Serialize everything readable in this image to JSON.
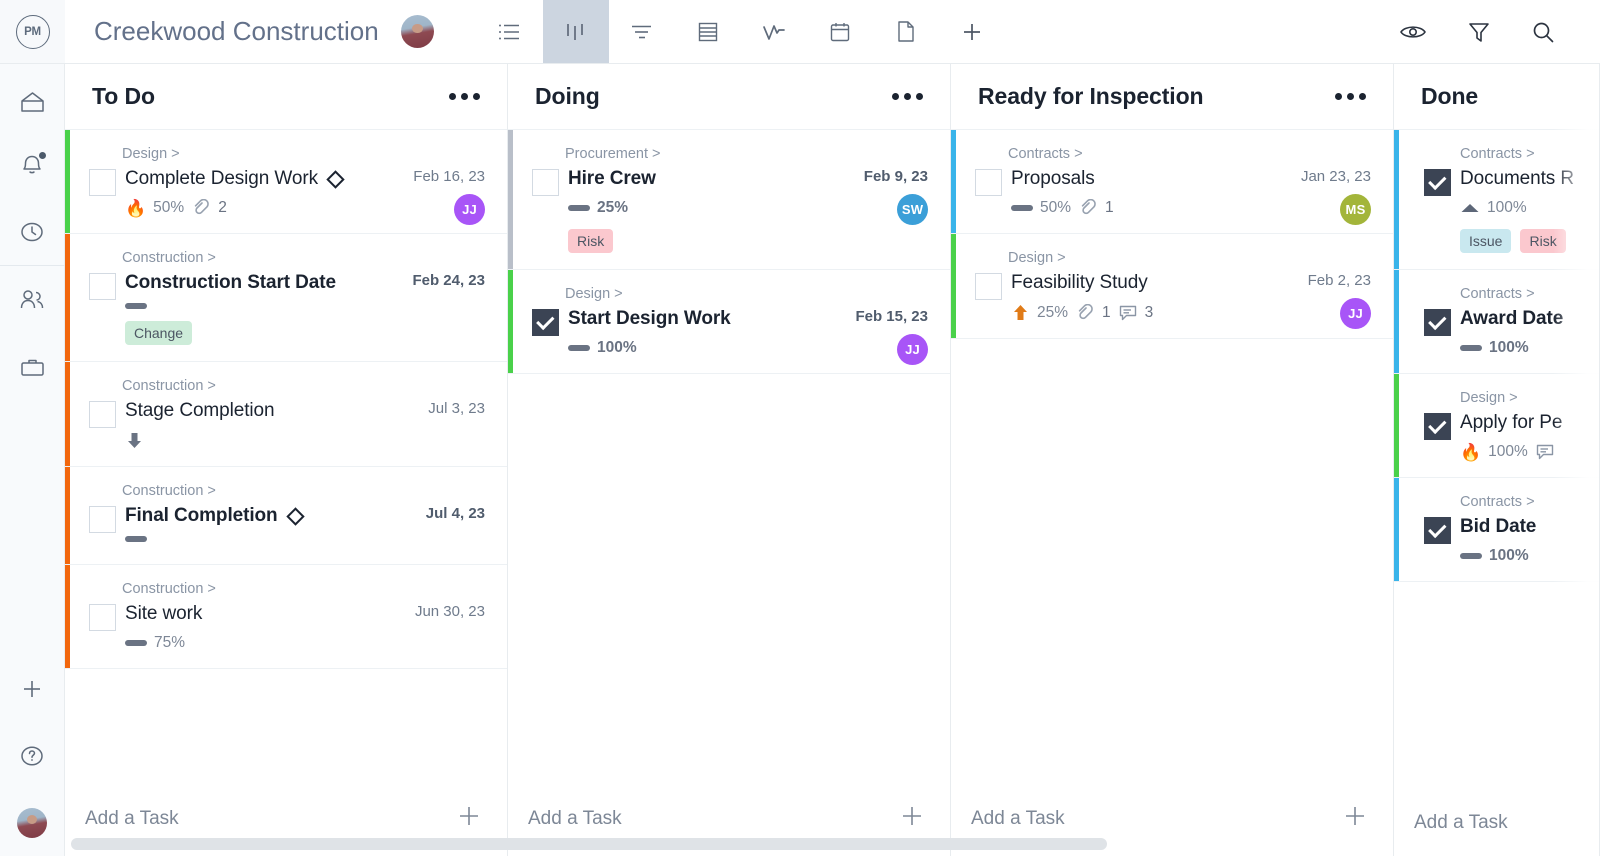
{
  "header": {
    "logo_text": "PM",
    "project_title": "Creekwood Construction",
    "avatar_name": "project-owner-avatar",
    "view_tabs": [
      {
        "icon": "list-view-icon",
        "label": "List",
        "active": false
      },
      {
        "icon": "board-view-icon",
        "label": "Board",
        "active": true
      },
      {
        "icon": "gantt-view-icon",
        "label": "Gantt",
        "active": false
      },
      {
        "icon": "sheet-view-icon",
        "label": "Sheet",
        "active": false
      },
      {
        "icon": "workload-view-icon",
        "label": "Workload",
        "active": false
      },
      {
        "icon": "calendar-view-icon",
        "label": "Calendar",
        "active": false
      },
      {
        "icon": "page-view-icon",
        "label": "Page",
        "active": false
      },
      {
        "icon": "add-view-icon",
        "label": "Add view",
        "active": false
      }
    ],
    "right_actions": [
      {
        "icon": "eye-icon",
        "label": "Watch"
      },
      {
        "icon": "filter-icon",
        "label": "Filter"
      },
      {
        "icon": "search-icon",
        "label": "Search"
      }
    ]
  },
  "sidebar": {
    "items": [
      {
        "icon": "home-icon",
        "label": "Home"
      },
      {
        "icon": "bell-icon",
        "label": "Notifications",
        "badge": true
      },
      {
        "icon": "clock-icon",
        "label": "Time"
      },
      {
        "icon": "people-icon",
        "label": "Team"
      },
      {
        "icon": "briefcase-icon",
        "label": "Portfolio"
      }
    ],
    "bottom_items": [
      {
        "icon": "plus-icon",
        "label": "Add"
      },
      {
        "icon": "help-icon",
        "label": "Help"
      },
      {
        "icon": "user-avatar",
        "label": "Account"
      }
    ]
  },
  "board": {
    "add_task_label": "Add a Task",
    "columns": [
      {
        "title": "To Do",
        "clipped": false,
        "cards": [
          {
            "category": "Design >",
            "title": "Complete Design Work",
            "bold": false,
            "milestone": true,
            "checked": false,
            "accent": "#4ad14a",
            "date": "Feb 16, 23",
            "date_bold": false,
            "priority": "flame",
            "progress": "50%",
            "progress_bold": false,
            "links": "2",
            "comments": null,
            "avatar": {
              "initials": "JJ",
              "color": "#a855f7"
            },
            "tags": []
          },
          {
            "category": "Construction >",
            "title": "Construction Start Date",
            "bold": true,
            "milestone": false,
            "checked": false,
            "accent": "#f2670e",
            "date": "Feb 24, 23",
            "date_bold": true,
            "priority": "bar",
            "progress": "",
            "progress_bold": true,
            "links": null,
            "comments": null,
            "avatar": null,
            "tags": [
              {
                "label": "Change",
                "style": "change"
              }
            ]
          },
          {
            "category": "Construction >",
            "title": "Stage Completion",
            "bold": false,
            "milestone": false,
            "checked": false,
            "accent": "#f2670e",
            "date": "Jul 3, 23",
            "date_bold": false,
            "priority": "down",
            "progress": "",
            "progress_bold": false,
            "links": null,
            "comments": null,
            "avatar": null,
            "tags": []
          },
          {
            "category": "Construction >",
            "title": "Final Completion",
            "bold": true,
            "milestone": true,
            "checked": false,
            "accent": "#f2670e",
            "date": "Jul 4, 23",
            "date_bold": true,
            "priority": "bar",
            "progress": "",
            "progress_bold": true,
            "links": null,
            "comments": null,
            "avatar": null,
            "tags": []
          },
          {
            "category": "Construction >",
            "title": "Site work",
            "bold": false,
            "milestone": false,
            "checked": false,
            "accent": "#f2670e",
            "date": "Jun 30, 23",
            "date_bold": false,
            "priority": "bar",
            "progress": "75%",
            "progress_bold": false,
            "links": null,
            "comments": null,
            "avatar": null,
            "tags": []
          }
        ]
      },
      {
        "title": "Doing",
        "clipped": false,
        "cards": [
          {
            "category": "Procurement >",
            "title": "Hire Crew",
            "bold": true,
            "milestone": false,
            "checked": false,
            "accent": "#b9bfc9",
            "date": "Feb 9, 23",
            "date_bold": true,
            "priority": "bar",
            "progress": "25%",
            "progress_bold": true,
            "links": null,
            "comments": null,
            "avatar": {
              "initials": "SW",
              "color": "#3b9fd8"
            },
            "tags": [
              {
                "label": "Risk",
                "style": "risk"
              }
            ]
          },
          {
            "category": "Design >",
            "title": "Start Design Work",
            "bold": true,
            "milestone": false,
            "checked": true,
            "accent": "#4ad14a",
            "date": "Feb 15, 23",
            "date_bold": true,
            "priority": "bar",
            "progress": "100%",
            "progress_bold": true,
            "links": null,
            "comments": null,
            "avatar": {
              "initials": "JJ",
              "color": "#a855f7"
            },
            "tags": []
          }
        ]
      },
      {
        "title": "Ready for Inspection",
        "clipped": false,
        "cards": [
          {
            "category": "Contracts >",
            "title": "Proposals",
            "bold": false,
            "milestone": false,
            "checked": false,
            "accent": "#39b4ea",
            "date": "Jan 23, 23",
            "date_bold": false,
            "priority": "bar",
            "progress": "50%",
            "progress_bold": false,
            "links": "1",
            "comments": null,
            "avatar": {
              "initials": "MS",
              "color": "#a3b53a"
            },
            "tags": []
          },
          {
            "category": "Design >",
            "title": "Feasibility Study",
            "bold": false,
            "milestone": false,
            "checked": false,
            "accent": "#4ad14a",
            "date": "Feb 2, 23",
            "date_bold": false,
            "priority": "up",
            "progress": "25%",
            "progress_bold": false,
            "links": "1",
            "comments": "3",
            "avatar": {
              "initials": "JJ",
              "color": "#a855f7"
            },
            "tags": []
          }
        ]
      },
      {
        "title": "Done",
        "clipped": true,
        "cards": [
          {
            "category": "Contracts >",
            "title": "Documents R",
            "bold": false,
            "milestone": false,
            "checked": true,
            "accent": "#39b4ea",
            "date": "",
            "date_bold": false,
            "priority": "triangle",
            "progress": "100%",
            "progress_bold": false,
            "links": null,
            "comments": null,
            "avatar": null,
            "tags": [
              {
                "label": "Issue",
                "style": "issue"
              },
              {
                "label": "Risk",
                "style": "risk"
              }
            ]
          },
          {
            "category": "Contracts >",
            "title": "Award Date",
            "bold": true,
            "milestone": false,
            "checked": true,
            "accent": "#39b4ea",
            "date": "",
            "date_bold": false,
            "priority": "bar",
            "progress": "100%",
            "progress_bold": true,
            "links": null,
            "comments": null,
            "avatar": null,
            "tags": []
          },
          {
            "category": "Design >",
            "title": "Apply for Pe",
            "bold": false,
            "milestone": false,
            "checked": true,
            "accent": "#4ad14a",
            "date": "",
            "date_bold": false,
            "priority": "flame",
            "progress": "100%",
            "progress_bold": false,
            "links": null,
            "comments": "",
            "avatar": null,
            "tags": []
          },
          {
            "category": "Contracts >",
            "title": "Bid Date",
            "bold": true,
            "milestone": false,
            "checked": true,
            "accent": "#39b4ea",
            "date": "",
            "date_bold": false,
            "priority": "bar",
            "progress": "100%",
            "progress_bold": true,
            "links": null,
            "comments": null,
            "avatar": null,
            "tags": []
          }
        ]
      }
    ]
  },
  "colors": {
    "accent_green": "#4ad14a",
    "accent_orange": "#f2670e",
    "accent_blue": "#39b4ea",
    "accent_gray": "#b9bfc9",
    "tab_active_bg": "#ccd5e0"
  }
}
